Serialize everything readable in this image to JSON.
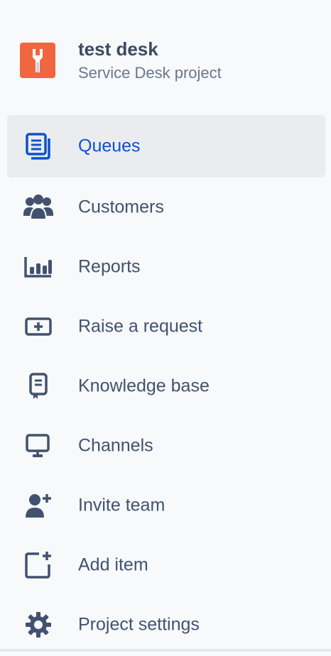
{
  "project": {
    "name": "test desk",
    "type": "Service Desk project",
    "avatar_icon": "wrench-icon",
    "avatar_color": "#f26541"
  },
  "colors": {
    "active_text": "#0c52cc",
    "text": "#42526e",
    "active_bg": "#ebecf0"
  },
  "nav": {
    "items": [
      {
        "label": "Queues",
        "icon": "queues-icon",
        "active": true
      },
      {
        "label": "Customers",
        "icon": "customers-icon",
        "active": false
      },
      {
        "label": "Reports",
        "icon": "reports-icon",
        "active": false
      },
      {
        "label": "Raise a request",
        "icon": "raise-request-icon",
        "active": false
      },
      {
        "label": "Knowledge base",
        "icon": "knowledge-base-icon",
        "active": false
      },
      {
        "label": "Channels",
        "icon": "channels-icon",
        "active": false
      },
      {
        "label": "Invite team",
        "icon": "invite-team-icon",
        "active": false
      },
      {
        "label": "Add item",
        "icon": "add-item-icon",
        "active": false
      },
      {
        "label": "Project settings",
        "icon": "gear-icon",
        "active": false
      }
    ]
  }
}
